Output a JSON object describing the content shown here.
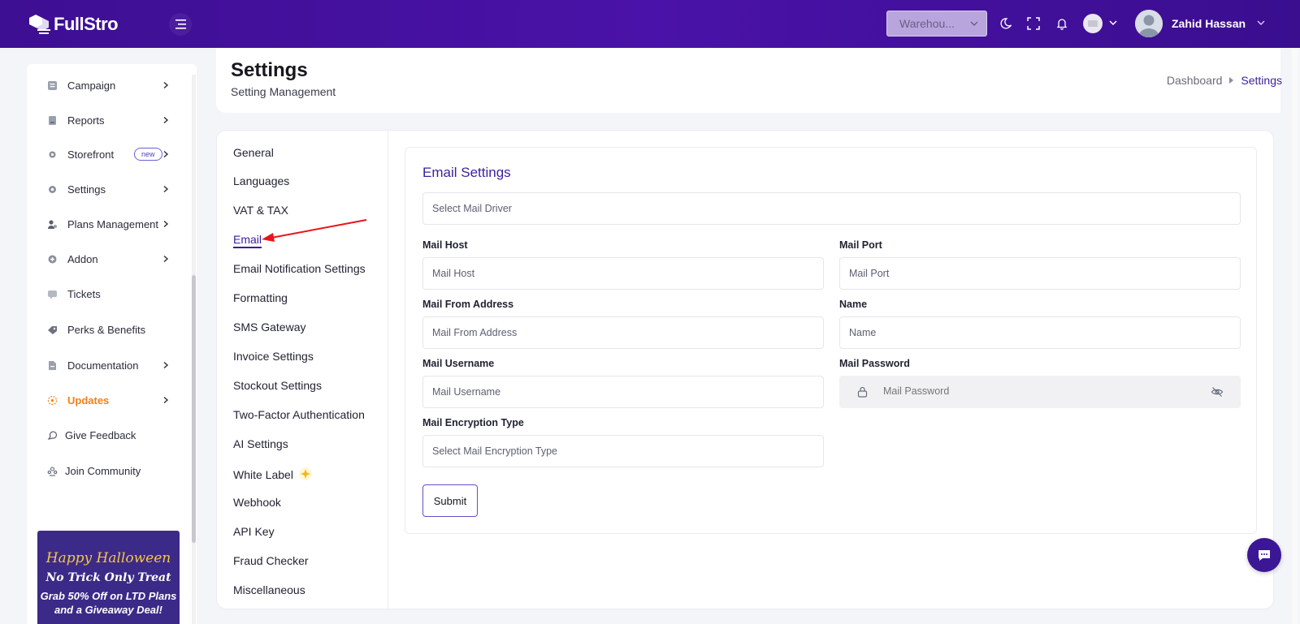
{
  "header": {
    "logo_text": "FullStro",
    "warehouse_select": "Warehou...",
    "user_name": "Zahid Hassan"
  },
  "sidebar": {
    "items": [
      {
        "label": "Campaign",
        "icon": "campaign-icon",
        "has_chevron": true
      },
      {
        "label": "Reports",
        "icon": "reports-icon",
        "has_chevron": true
      },
      {
        "label": "Storefront",
        "icon": "storefront-icon",
        "has_chevron": true,
        "badge": "new"
      },
      {
        "label": "Settings",
        "icon": "settings-icon",
        "has_chevron": true
      },
      {
        "label": "Plans Management",
        "icon": "plans-icon",
        "has_chevron": true
      },
      {
        "label": "Addon",
        "icon": "addon-icon",
        "has_chevron": true
      },
      {
        "label": "Tickets",
        "icon": "tickets-icon",
        "has_chevron": false
      },
      {
        "label": "Perks & Benefits",
        "icon": "perks-icon",
        "has_chevron": false
      },
      {
        "label": "Documentation",
        "icon": "documentation-icon",
        "has_chevron": true
      },
      {
        "label": "Updates",
        "icon": "updates-icon",
        "has_chevron": true
      },
      {
        "label": "Give Feedback",
        "icon": "feedback-icon",
        "has_chevron": false
      },
      {
        "label": "Join Community",
        "icon": "community-icon",
        "has_chevron": false
      }
    ],
    "promo": {
      "line1": "Happy Halloween",
      "line2": "No Trick Only Treat",
      "line3": "Grab 50% Off on LTD Plans",
      "line4": "and a Giveaway Deal!"
    }
  },
  "page": {
    "title": "Settings",
    "subtitle": "Setting Management",
    "breadcrumb": {
      "home": "Dashboard",
      "current": "Settings"
    }
  },
  "settings_menu": [
    "General",
    "Languages",
    "VAT & TAX",
    "Email",
    "Email Notification Settings",
    "Formatting",
    "SMS Gateway",
    "Invoice Settings",
    "Stockout Settings",
    "Two-Factor Authentication",
    "AI Settings",
    "White Label",
    "Webhook",
    "API Key",
    "Fraud Checker",
    "Miscellaneous"
  ],
  "active_menu": "Email",
  "email_settings": {
    "title": "Email Settings",
    "driver_placeholder": "Select Mail Driver",
    "fields": {
      "mail_host": {
        "label": "Mail Host",
        "placeholder": "Mail Host"
      },
      "mail_port": {
        "label": "Mail Port",
        "placeholder": "Mail Port"
      },
      "mail_from": {
        "label": "Mail From Address",
        "placeholder": "Mail From Address"
      },
      "name": {
        "label": "Name",
        "placeholder": "Name"
      },
      "mail_username": {
        "label": "Mail Username",
        "placeholder": "Mail Username"
      },
      "mail_password": {
        "label": "Mail Password",
        "placeholder": "Mail Password"
      },
      "encryption": {
        "label": "Mail Encryption Type",
        "placeholder": "Select Mail Encryption Type"
      }
    },
    "submit_label": "Submit"
  },
  "colors": {
    "brand": "#3d0f92",
    "accent": "#3b1f9e",
    "updates": "#f57f17",
    "annotation_arrow": "#e8141b"
  }
}
